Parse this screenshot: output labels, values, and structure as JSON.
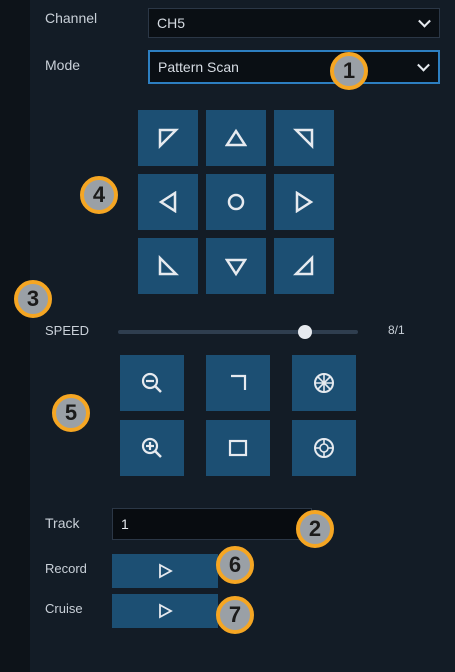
{
  "channel": {
    "label": "Channel",
    "value": "CH5"
  },
  "mode": {
    "label": "Mode",
    "value": "Pattern Scan"
  },
  "speed": {
    "label": "SPEED",
    "value": "8/1",
    "level_fraction": 0.78
  },
  "track": {
    "label": "Track",
    "value": "1"
  },
  "record": {
    "label": "Record"
  },
  "cruise": {
    "label": "Cruise"
  },
  "badges": [
    "1",
    "2",
    "3",
    "4",
    "5",
    "6",
    "7"
  ],
  "icons": {
    "ptz": [
      "arrow-up-left-icon",
      "arrow-up-icon",
      "arrow-up-right-icon",
      "arrow-left-icon",
      "center-circle-icon",
      "arrow-right-icon",
      "arrow-down-left-icon",
      "arrow-down-icon",
      "arrow-down-right-icon"
    ],
    "lens": [
      "zoom-out-icon",
      "focus-near-icon",
      "iris-open-icon",
      "zoom-in-icon",
      "focus-far-icon",
      "iris-close-icon"
    ],
    "play": "play-icon"
  },
  "colors": {
    "accent": "#2d7fc1",
    "button": "#1c4f73",
    "badge_border": "#f5a623",
    "badge_fill": "#9aa0a6"
  }
}
